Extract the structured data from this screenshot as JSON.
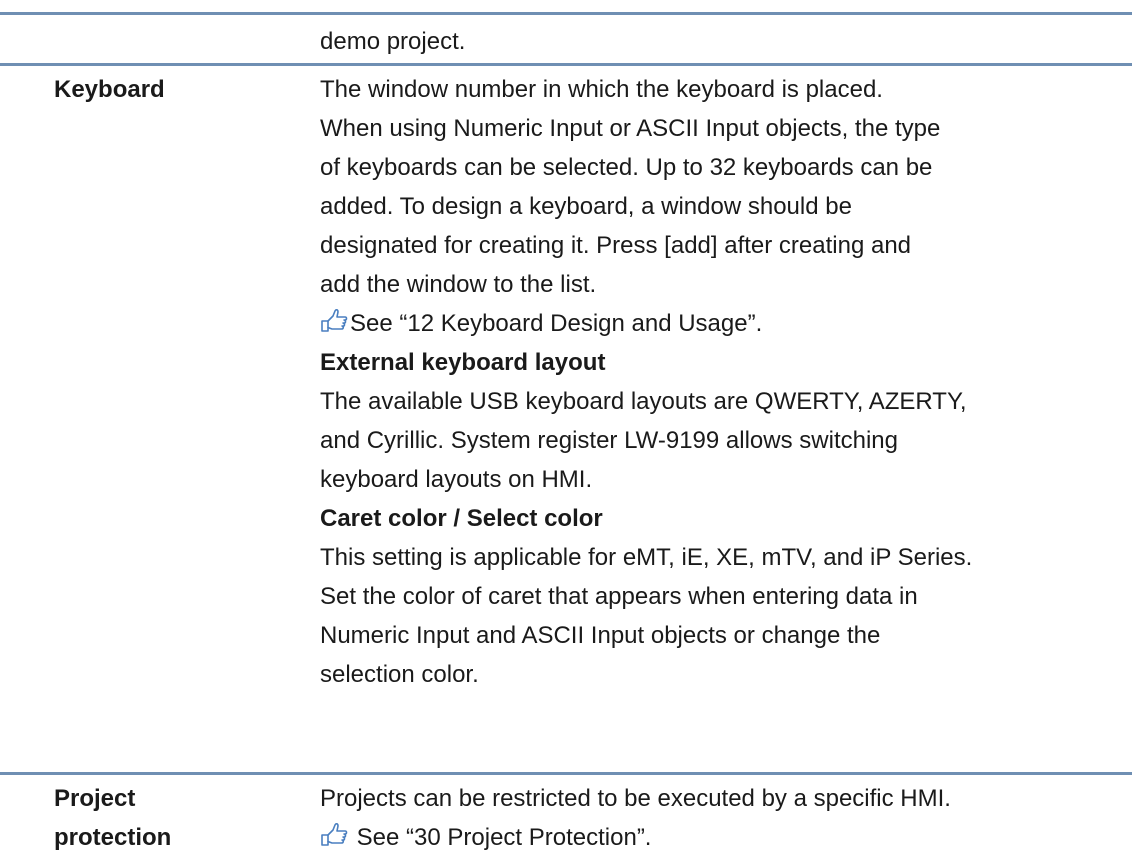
{
  "row0": {
    "content": [
      "demo project."
    ]
  },
  "keyboard": {
    "label": "Keyboard",
    "intro": [
      "The window number in which the keyboard is placed.",
      "When using Numeric Input or ASCII Input objects, the type",
      "of keyboards can be selected. Up to 32 keyboards can be",
      "added. To design a keyboard, a window should be",
      "designated for creating it. Press [add] after creating and",
      "add the window to the list."
    ],
    "see": "See “12 Keyboard Design and Usage”.",
    "external_heading": "External keyboard layout",
    "external": [
      "The available USB keyboard layouts are QWERTY, AZERTY,",
      "and Cyrillic. System register LW-9199 allows switching",
      "keyboard layouts on HMI."
    ],
    "caret_heading": "Caret color / Select color",
    "caret": [
      "This setting is applicable for eMT, iE, XE, mTV, and iP Series.",
      "Set the color of caret that appears when entering data in",
      "Numeric Input and ASCII Input objects or change the",
      "selection color."
    ]
  },
  "project_protection": {
    "label_line1": "Project",
    "label_line2": "protection",
    "line1": "Projects can be restricted to be executed by a specific HMI.",
    "see": " See “30 Project Protection”."
  },
  "colors": {
    "rule": "#6f8fb3",
    "icon": "#4a7fc0"
  }
}
